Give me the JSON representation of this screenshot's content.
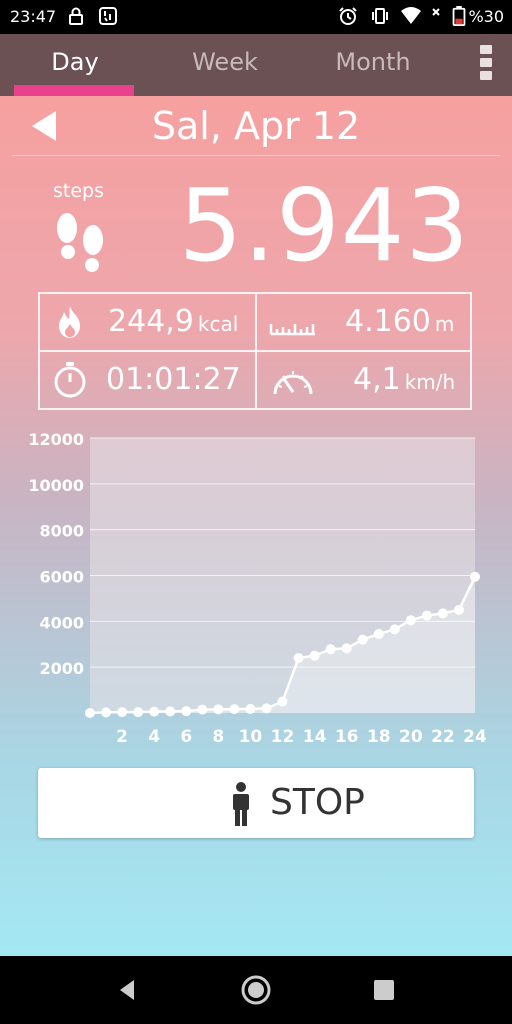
{
  "status_bar": {
    "time": "23:47",
    "battery": "%30",
    "icons": [
      "lock-icon",
      "app-notification-icon",
      "alarm-icon",
      "vibrate-icon",
      "wifi-icon",
      "battery-icon"
    ]
  },
  "tabs": [
    {
      "label": "Day",
      "active": true
    },
    {
      "label": "Week",
      "active": false
    },
    {
      "label": "Month",
      "active": false
    }
  ],
  "date": "Sal, Apr 12",
  "steps": {
    "label": "steps",
    "value": "5.943"
  },
  "stats": {
    "calories": {
      "value": "244,9",
      "unit": "kcal"
    },
    "distance": {
      "value": "4.160",
      "unit": "m"
    },
    "duration": {
      "value": "01:01:27"
    },
    "speed": {
      "value": "4,1",
      "unit": "km/h"
    }
  },
  "chart_data": {
    "type": "line",
    "ylim": [
      0,
      12000
    ],
    "y_ticks": [
      2000,
      4000,
      6000,
      8000,
      10000,
      12000
    ],
    "x_ticks": [
      2,
      4,
      6,
      8,
      10,
      12,
      14,
      16,
      18,
      20,
      22,
      24
    ],
    "xlim": [
      0,
      24
    ],
    "grid": true,
    "series": [
      {
        "x": [
          0,
          1,
          2,
          3,
          4,
          5,
          6,
          7,
          8,
          9,
          10,
          11,
          12,
          13,
          14,
          15,
          16,
          17,
          18,
          19,
          20,
          21,
          22,
          23,
          24
        ],
        "values": [
          0,
          30,
          40,
          40,
          60,
          70,
          80,
          150,
          160,
          170,
          180,
          200,
          500,
          2400,
          2500,
          2780,
          2820,
          3200,
          3450,
          3650,
          4050,
          4250,
          4350,
          4500,
          5943
        ]
      }
    ],
    "colors": {
      "line": "#ffffff",
      "fill": "#ffffff",
      "plot_bg": "#e8e2e6"
    }
  },
  "stop_button": {
    "label": "STOP"
  },
  "nav": [
    "back-icon",
    "home-icon",
    "recents-icon"
  ]
}
